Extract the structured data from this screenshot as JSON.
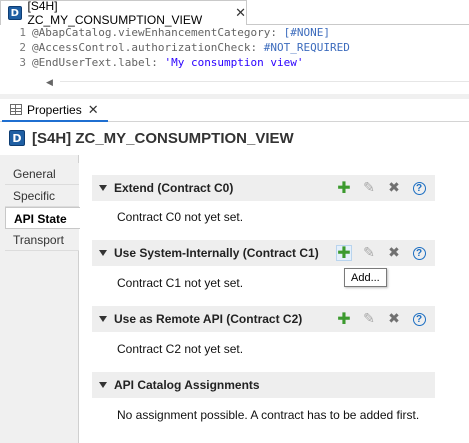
{
  "editor": {
    "tab_title": "[S4H] ZC_MY_CONSUMPTION_VIEW",
    "tab_close": "✕",
    "lines": [
      {
        "num": "1",
        "ann": "@AbapCatalog.viewEnhancementCategory: ",
        "val": "[#NONE]"
      },
      {
        "num": "2",
        "ann": "@AccessControl.authorizationCheck: ",
        "val": "#NOT_REQUIRED"
      },
      {
        "num": "3",
        "ann": "@EndUserText.label: ",
        "val": "'My consumption view'"
      }
    ]
  },
  "properties": {
    "tab_label": "Properties",
    "tab_close": "✕",
    "header_title": "[S4H] ZC_MY_CONSUMPTION_VIEW",
    "side_tabs": [
      "General",
      "Specific",
      "API State",
      "Transport"
    ],
    "active_side_tab": "API State",
    "sections": [
      {
        "title": "Extend (Contract C0)",
        "text": "Contract C0 not yet set."
      },
      {
        "title": "Use System-Internally (Contract C1)",
        "text": "Contract C1 not yet set."
      },
      {
        "title": "Use as Remote API (Contract C2)",
        "text": "Contract C2 not yet set."
      },
      {
        "title": "API Catalog Assignments",
        "text": "No assignment possible. A contract has to be added first."
      }
    ],
    "tooltip": "Add..."
  },
  "icons": {
    "editor_tab": "ddl-source-icon",
    "properties_tab": "properties-grid-icon",
    "add": "plus-icon",
    "edit": "pencil-icon",
    "remove": "delete-x-icon",
    "help": "help-icon"
  },
  "colors": {
    "accent": "#1f6fd1",
    "add_green": "#3c9a2e",
    "help_blue": "#1b6ec2",
    "string_literal": "#2a00ff"
  }
}
